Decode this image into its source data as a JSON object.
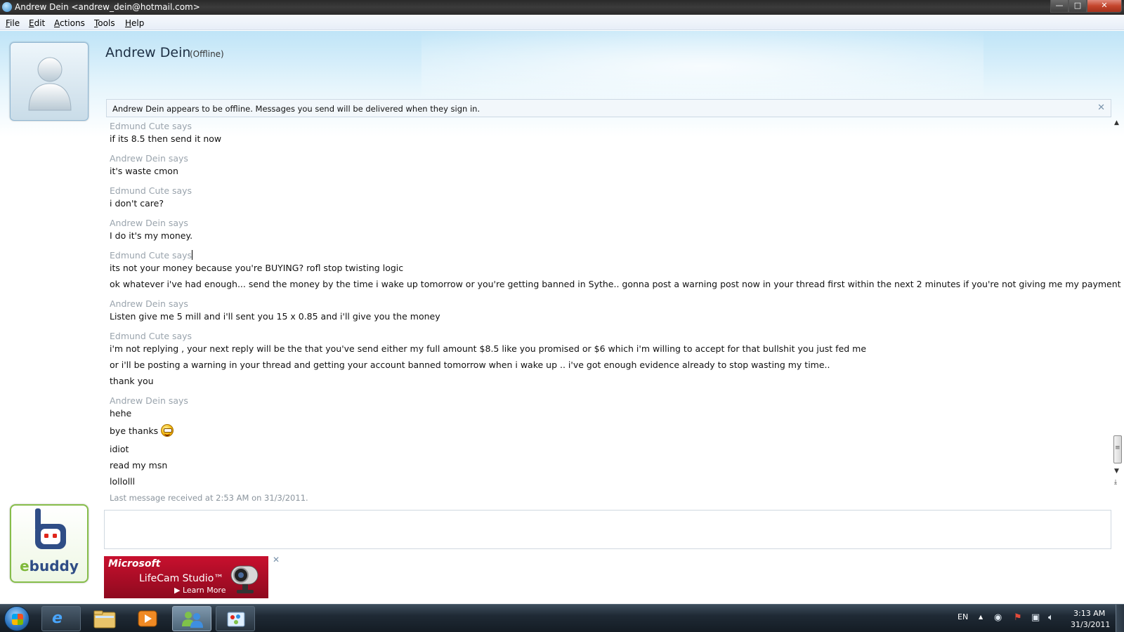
{
  "window": {
    "title": "Andrew Dein <andrew_dein@hotmail.com>",
    "buttons": {
      "minimize": "—",
      "maximize": "□",
      "close": "✕"
    }
  },
  "menu": [
    "File",
    "Edit",
    "Actions",
    "Tools",
    "Help"
  ],
  "contact": {
    "name": "Andrew Dein",
    "status": "(Offline)"
  },
  "infobar": {
    "text": "Andrew Dein appears to be offline. Messages you send will be delivered when they sign in.",
    "close": "✕"
  },
  "conversation": [
    {
      "kind": "sender",
      "text": "Edmund Cute says"
    },
    {
      "kind": "text",
      "text": "if its 8.5 then send it now"
    },
    {
      "kind": "sender",
      "text": "Andrew Dein says"
    },
    {
      "kind": "text",
      "text": "it's waste cmon"
    },
    {
      "kind": "sender",
      "text": "Edmund Cute says"
    },
    {
      "kind": "text",
      "text": "i don't care?"
    },
    {
      "kind": "sender",
      "text": "Andrew Dein says"
    },
    {
      "kind": "text",
      "text": "I do it's my money."
    },
    {
      "kind": "sender",
      "text": "Edmund Cute says"
    },
    {
      "kind": "text",
      "text": "its not your money because you're BUYING? rofl stop twisting logic"
    },
    {
      "kind": "text",
      "text": "ok whatever i've had enough... send the money by the time i wake up tomorrow or you're getting banned in Sythe.. gonna post a warning post now in your thread first within the next 2 minutes if you're not giving me my payment"
    },
    {
      "kind": "sender",
      "text": "Andrew Dein says"
    },
    {
      "kind": "text",
      "text": "Listen give me 5 mill and i'll sent you 15 x 0.85 and i'll give you the money"
    },
    {
      "kind": "sender",
      "text": "Edmund Cute says"
    },
    {
      "kind": "text",
      "text": "i'm not replying , your next reply will be the that you've send either my full amount $8.5 like you promised or $6 which i'm willing to accept for that bullshit you just fed me"
    },
    {
      "kind": "text",
      "text": "or i'll be posting a warning in your thread and getting your account banned tomorrow when i wake up .. i've got enough evidence already to stop wasting my time.."
    },
    {
      "kind": "text",
      "text": "thank you"
    },
    {
      "kind": "sender",
      "text": "Andrew Dein says"
    },
    {
      "kind": "text",
      "text": "hehe"
    },
    {
      "kind": "text",
      "text": "bye thanks",
      "emoticon": "grin-emoticon"
    },
    {
      "kind": "text",
      "text": "idiot"
    },
    {
      "kind": "text",
      "text": "read my msn"
    },
    {
      "kind": "text",
      "text": "lollolll"
    },
    {
      "kind": "footer",
      "text": "Last message received at 2:53 AM on 31/3/2011."
    }
  ],
  "logo": {
    "text_e": "e",
    "text_rest": "buddy"
  },
  "ad": {
    "brand": "Microsoft",
    "product": "LifeCam Studio™",
    "cta": "▶ Learn More",
    "close": "✕"
  },
  "taskbar": {
    "language": "EN",
    "tray_arrow": "▲",
    "time": "3:13 AM",
    "date": "31/3/2011"
  },
  "colors": {
    "sender": "#9aa4ad",
    "accent_blue": "#2f4d86",
    "ebuddy_green": "#7fb93a",
    "ad_red": "#c8102e"
  }
}
